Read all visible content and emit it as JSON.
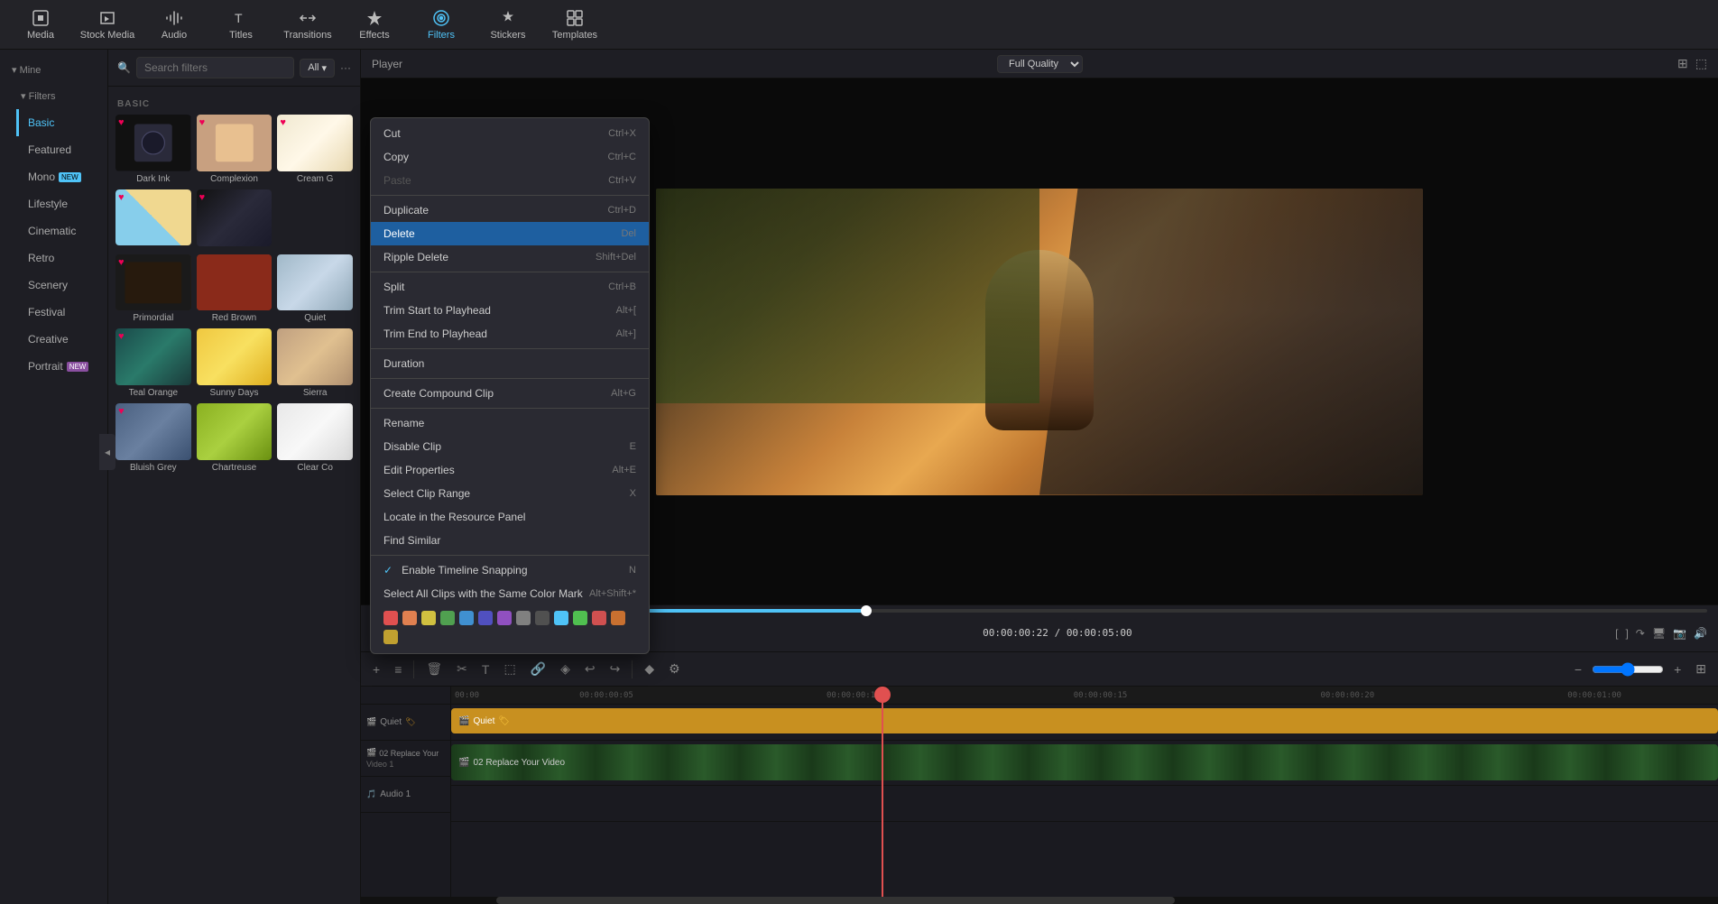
{
  "toolbar": {
    "buttons": [
      {
        "id": "media",
        "label": "Media",
        "icon": "◻"
      },
      {
        "id": "stock-media",
        "label": "Stock Media",
        "icon": "🎬"
      },
      {
        "id": "audio",
        "label": "Audio",
        "icon": "♪"
      },
      {
        "id": "titles",
        "label": "Titles",
        "icon": "T"
      },
      {
        "id": "transitions",
        "label": "Transitions",
        "icon": "⇄"
      },
      {
        "id": "effects",
        "label": "Effects",
        "icon": "✦"
      },
      {
        "id": "filters",
        "label": "Filters",
        "icon": "◈"
      },
      {
        "id": "stickers",
        "label": "Stickers",
        "icon": "★"
      },
      {
        "id": "templates",
        "label": "Templates",
        "icon": "⊞"
      }
    ]
  },
  "sidebar": {
    "parent_label": "Filters",
    "items": [
      {
        "id": "basic",
        "label": "Basic",
        "active": true
      },
      {
        "id": "featured",
        "label": "Featured"
      },
      {
        "id": "mono",
        "label": "Mono",
        "badge": "NEW"
      },
      {
        "id": "lifestyle",
        "label": "Lifestyle"
      },
      {
        "id": "cinematic",
        "label": "Cinematic"
      },
      {
        "id": "retro",
        "label": "Retro"
      },
      {
        "id": "scenery",
        "label": "Scenery"
      },
      {
        "id": "festival",
        "label": "Festival"
      },
      {
        "id": "creative",
        "label": "Creative"
      },
      {
        "id": "portrait",
        "label": "Portrait",
        "badge": "NEW"
      }
    ]
  },
  "filters_panel": {
    "search_placeholder": "Search filters",
    "filter_tag": "All",
    "section_label": "BASIC",
    "items": [
      {
        "id": "dark-ink",
        "name": "Dark Ink",
        "thumb_class": "th-dark-ink",
        "hearted": true
      },
      {
        "id": "complexion",
        "name": "Complexion",
        "thumb_class": "th-complexion",
        "hearted": true
      },
      {
        "id": "cream-g",
        "name": "Cream G",
        "thumb_class": "th-cream",
        "hearted": true
      },
      {
        "id": "g1",
        "name": "",
        "thumb_class": "th-beach",
        "hearted": true
      },
      {
        "id": "g2",
        "name": "",
        "thumb_class": "th-dark-ink",
        "hearted": true
      },
      {
        "id": "primordial",
        "name": "Primordial",
        "thumb_class": "th-primordial",
        "hearted": true
      },
      {
        "id": "red-brown",
        "name": "Red Brown",
        "thumb_class": "th-red-brown",
        "hearted": false
      },
      {
        "id": "quiet",
        "name": "Quiet",
        "thumb_class": "th-quiet",
        "hearted": false
      },
      {
        "id": "teal-orange",
        "name": "Teal Orange",
        "thumb_class": "th-teal",
        "hearted": true
      },
      {
        "id": "sunny-days",
        "name": "Sunny Days",
        "thumb_class": "th-sunny",
        "hearted": false
      },
      {
        "id": "sierra",
        "name": "Sierra",
        "thumb_class": "th-sierra",
        "hearted": false
      },
      {
        "id": "bluish-grey",
        "name": "Bluish Grey",
        "thumb_class": "th-bluish",
        "hearted": true
      },
      {
        "id": "chartreuse",
        "name": "Chartreuse",
        "thumb_class": "th-chartreuse",
        "hearted": false
      },
      {
        "id": "clear-co",
        "name": "Clear Co",
        "thumb_class": "th-clearco",
        "hearted": false
      }
    ]
  },
  "context_menu": {
    "items": [
      {
        "id": "cut",
        "label": "Cut",
        "shortcut": "Ctrl+X",
        "type": "item"
      },
      {
        "id": "copy",
        "label": "Copy",
        "shortcut": "Ctrl+C",
        "type": "item"
      },
      {
        "id": "paste",
        "label": "Paste",
        "shortcut": "Ctrl+V",
        "type": "item",
        "disabled": true
      },
      {
        "id": "sep1",
        "type": "separator"
      },
      {
        "id": "duplicate",
        "label": "Duplicate",
        "shortcut": "Ctrl+D",
        "type": "item"
      },
      {
        "id": "delete",
        "label": "Delete",
        "shortcut": "Del",
        "type": "item",
        "highlighted": true
      },
      {
        "id": "ripple-delete",
        "label": "Ripple Delete",
        "shortcut": "Shift+Del",
        "type": "item"
      },
      {
        "id": "sep2",
        "type": "separator"
      },
      {
        "id": "split",
        "label": "Split",
        "shortcut": "Ctrl+B",
        "type": "item"
      },
      {
        "id": "trim-start",
        "label": "Trim Start to Playhead",
        "shortcut": "Alt+[",
        "type": "item"
      },
      {
        "id": "trim-end",
        "label": "Trim End to Playhead",
        "shortcut": "Alt+]",
        "type": "item"
      },
      {
        "id": "sep3",
        "type": "separator"
      },
      {
        "id": "duration",
        "label": "Duration",
        "shortcut": "",
        "type": "item"
      },
      {
        "id": "sep4",
        "type": "separator"
      },
      {
        "id": "compound-clip",
        "label": "Create Compound Clip",
        "shortcut": "Alt+G",
        "type": "item"
      },
      {
        "id": "sep5",
        "type": "separator"
      },
      {
        "id": "rename",
        "label": "Rename",
        "shortcut": "",
        "type": "item"
      },
      {
        "id": "disable-clip",
        "label": "Disable Clip",
        "shortcut": "E",
        "type": "item"
      },
      {
        "id": "edit-properties",
        "label": "Edit Properties",
        "shortcut": "Alt+E",
        "type": "item"
      },
      {
        "id": "select-clip-range",
        "label": "Select Clip Range",
        "shortcut": "X",
        "type": "item"
      },
      {
        "id": "locate-resource",
        "label": "Locate in the Resource Panel",
        "shortcut": "",
        "type": "item"
      },
      {
        "id": "find-similar",
        "label": "Find Similar",
        "shortcut": "",
        "type": "item"
      },
      {
        "id": "sep6",
        "type": "separator"
      },
      {
        "id": "snapping",
        "label": "Enable Timeline Snapping",
        "shortcut": "N",
        "type": "item",
        "checked": true
      },
      {
        "id": "same-color",
        "label": "Select All Clips with the Same Color Mark",
        "shortcut": "Alt+Shift+*",
        "type": "item"
      },
      {
        "id": "colors",
        "type": "colors"
      }
    ],
    "colors": [
      "#e05050",
      "#e08050",
      "#d0c040",
      "#50a050",
      "#4090d0",
      "#5050c0",
      "#9050c0",
      "#808080",
      "#505050",
      "#4fc3f7",
      "#50c050",
      "#d05050",
      "#c87030",
      "#c0a030"
    ]
  },
  "player": {
    "label": "Player",
    "quality": "Full Quality",
    "current_time": "00:00:00:22",
    "total_time": "00:00:05:00",
    "progress_pct": 37
  },
  "timeline": {
    "ruler_marks": [
      "00:00",
      "00:00:00:05",
      "00:00:00:10",
      "00:00:00:15",
      "00:00:00:20",
      "00:00:01:00"
    ],
    "tracks": [
      {
        "id": "filter-track",
        "label": "Quiet",
        "type": "filter"
      },
      {
        "id": "video-1",
        "label": "Video 1",
        "clip_name": "02 Replace Your Video",
        "type": "video"
      },
      {
        "id": "audio-1",
        "label": "Audio 1",
        "type": "audio"
      }
    ]
  }
}
